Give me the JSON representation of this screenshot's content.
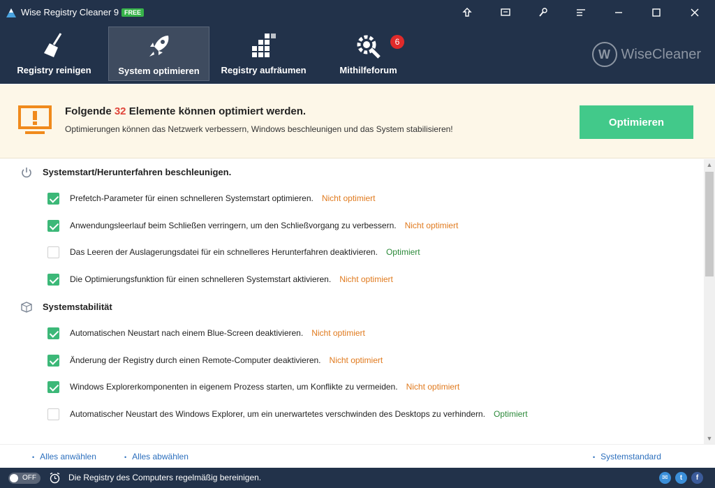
{
  "window": {
    "title": "Wise Registry Cleaner 9",
    "badge": "FREE",
    "controls": [
      "upload-icon",
      "message-icon",
      "tools-icon",
      "menu-icon",
      "minimize-icon",
      "maximize-icon",
      "close-icon"
    ]
  },
  "nav": {
    "items": [
      {
        "label": "Registry reinigen",
        "icon": "broom-icon",
        "active": false
      },
      {
        "label": "System optimieren",
        "icon": "rocket-icon",
        "active": true
      },
      {
        "label": "Registry aufräumen",
        "icon": "defrag-blocks-icon",
        "active": false
      },
      {
        "label": "Mithilfeforum",
        "icon": "gear-wrench-icon",
        "active": false,
        "badge": "6"
      }
    ],
    "brand": {
      "logo_letter": "W",
      "text": "WiseCleaner"
    }
  },
  "banner": {
    "title_prefix": "Folgende",
    "count": "32",
    "title_suffix": "Elemente können optimiert werden.",
    "subtitle": "Optimierungen können das Netzwerk verbessern, Windows beschleunigen und das System stabilisieren!",
    "button": "Optimieren"
  },
  "sections": [
    {
      "title": "Systemstart/Herunterfahren beschleunigen.",
      "icon": "power-icon",
      "items": [
        {
          "text": "Prefetch-Parameter für einen schnelleren Systemstart optimieren.",
          "status": "Nicht optimiert",
          "checked": true
        },
        {
          "text": "Anwendungsleerlauf beim Schließen verringern, um den Schließvorgang zu verbessern.",
          "status": "Nicht optimiert",
          "checked": true
        },
        {
          "text": "Das Leeren der Auslagerungsdatei für ein schnelleres Herunterfahren deaktivieren.",
          "status": "Optimiert",
          "checked": false
        },
        {
          "text": "Die Optimierungsfunktion für einen schnelleren Systemstart aktivieren.",
          "status": "Nicht optimiert",
          "checked": true
        }
      ]
    },
    {
      "title": "Systemstabilität",
      "icon": "cube-icon",
      "items": [
        {
          "text": "Automatischen Neustart nach einem Blue-Screen deaktivieren.",
          "status": "Nicht optimiert",
          "checked": true
        },
        {
          "text": "Änderung der Registry durch einen Remote-Computer deaktivieren.",
          "status": "Nicht optimiert",
          "checked": true
        },
        {
          "text": "Windows Explorerkomponenten in eigenem Prozess starten, um Konflikte zu vermeiden.",
          "status": "Nicht optimiert",
          "checked": true
        },
        {
          "text": "Automatischer Neustart des Windows Explorer, um ein unerwartetes verschwinden des Desktops zu verhindern.",
          "status": "Optimiert",
          "checked": false
        }
      ]
    }
  ],
  "links": {
    "select_all": "Alles anwählen",
    "deselect_all": "Alles abwählen",
    "default": "Systemstandard"
  },
  "statusbar": {
    "toggle": "OFF",
    "text": "Die Registry des Computers regelmäßig bereinigen.",
    "social": [
      "email-icon",
      "twitter-icon",
      "facebook-icon"
    ]
  },
  "colors": {
    "header_bg": "#22324a",
    "accent_green": "#42c98a",
    "not_optimized": "#e07a1e",
    "optimized": "#2c8a3a",
    "count_red": "#e0453a"
  }
}
